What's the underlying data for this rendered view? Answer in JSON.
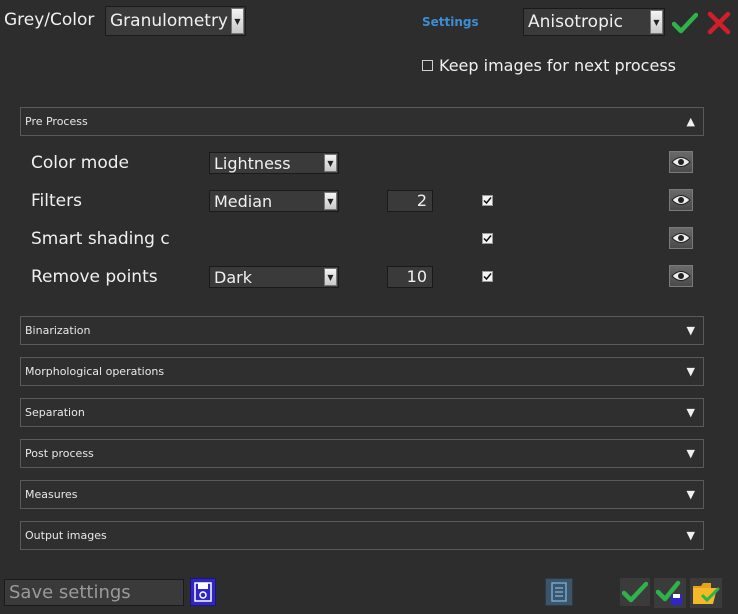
{
  "top": {
    "grey_color_label": "Grey/Color",
    "method_value": "Granulometry",
    "settings_label": "Settings",
    "preset_value": "Anisotropic"
  },
  "keep_images": {
    "label": "Keep images for next process",
    "checked": false
  },
  "sections": {
    "pre_process": "Pre Process",
    "binarization": "Binarization",
    "morphological": "Morphological operations",
    "separation": "Separation",
    "post_process": "Post process",
    "measures": "Measures",
    "output_images": "Output images"
  },
  "pre_process_rows": {
    "color_mode": {
      "label": "Color mode",
      "value": "Lightness"
    },
    "filters": {
      "label": "Filters",
      "value": "Median",
      "number": "2",
      "checked": true
    },
    "smart_shading": {
      "label": "Smart shading c",
      "checked": true
    },
    "remove_points": {
      "label": "Remove points",
      "value": "Dark",
      "number": "10",
      "checked": true
    }
  },
  "footer": {
    "save_placeholder": "Save settings"
  },
  "colors": {
    "accept": "#2fb24a",
    "reject": "#d21d2a",
    "link": "#3b8ed6",
    "save_icon": "#2f25c9"
  },
  "icons": [
    "check-icon",
    "close-icon",
    "eye-icon",
    "floppy-disk-icon",
    "document-icon",
    "check-save-icon",
    "folder-check-icon",
    "triangle-up-icon",
    "triangle-down-icon",
    "chevron-down-icon"
  ]
}
